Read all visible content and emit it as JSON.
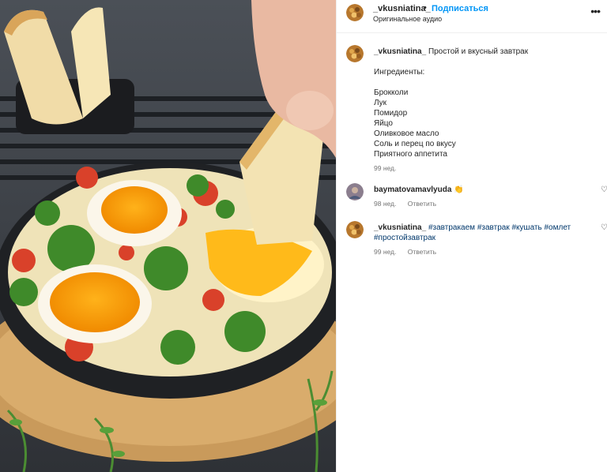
{
  "post": {
    "username": "_vkusniatina_",
    "dot": "•",
    "follow_label": "Подписаться",
    "audio_label": "Оригинальное аудио",
    "more_icon": "more-horizontal-icon"
  },
  "caption": {
    "username": "_vkusniatina_",
    "title": "Простой и вкусный завтрак",
    "ingredients_header": "Ингредиенты:",
    "ingredients": [
      "Брокколи",
      "Лук",
      "Помидор",
      "Яйцо",
      "Оливковое масло",
      "Соль и перец по вкусу",
      "Приятного аппетита"
    ],
    "time": "99 нед."
  },
  "comments": [
    {
      "username": "baymatovamavlyuda",
      "text": "👏",
      "time": "98 нед.",
      "reply": "Ответить"
    },
    {
      "username": "_vkusniatina_",
      "tags": [
        "#завтракаем",
        "#завтрак",
        "#кушать",
        "#омлет",
        "#простойзавтрак"
      ],
      "time": "99 нед.",
      "reply": "Ответить"
    }
  ],
  "icons": {
    "like": "heart-icon"
  },
  "colors": {
    "link": "#0095f6",
    "hashtag": "#00376b",
    "muted": "#737373",
    "text": "#262626"
  }
}
